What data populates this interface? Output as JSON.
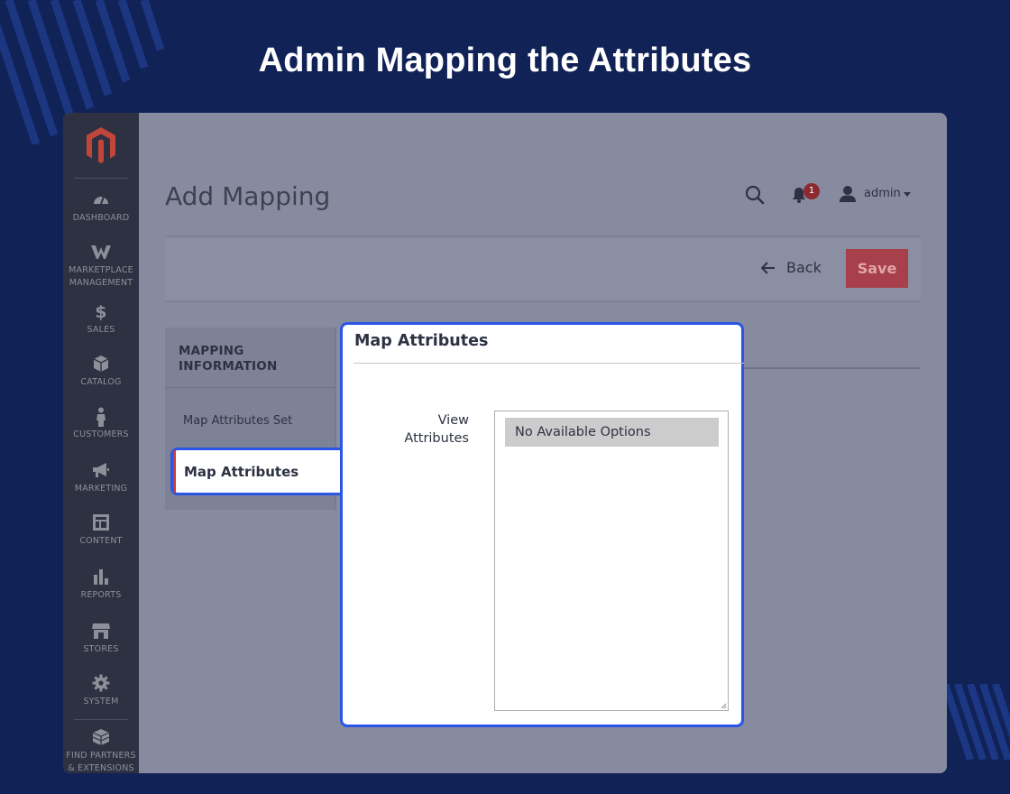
{
  "banner": {
    "title": "Admin Mapping the Attributes"
  },
  "colors": {
    "background": "#112256",
    "accent": "#2a55e6",
    "save": "#a7404a",
    "sidebar": "#2d3142"
  },
  "sidebar": {
    "items": [
      {
        "label": "DASHBOARD",
        "icon": "dashboard-icon"
      },
      {
        "label": "MARKETPLACE MANAGEMENT",
        "icon": "marketplace-icon"
      },
      {
        "label": "SALES",
        "icon": "dollar-icon"
      },
      {
        "label": "CATALOG",
        "icon": "box-icon"
      },
      {
        "label": "CUSTOMERS",
        "icon": "person-icon"
      },
      {
        "label": "MARKETING",
        "icon": "megaphone-icon"
      },
      {
        "label": "CONTENT",
        "icon": "layout-icon"
      },
      {
        "label": "REPORTS",
        "icon": "bar-chart-icon"
      },
      {
        "label": "STORES",
        "icon": "store-icon"
      },
      {
        "label": "SYSTEM",
        "icon": "gear-icon"
      },
      {
        "label": "FIND PARTNERS & EXTENSIONS",
        "icon": "cubes-icon"
      }
    ]
  },
  "header": {
    "page_title": "Add Mapping",
    "notifications_count": "1",
    "user_name": "admin"
  },
  "actions": {
    "back_label": "Back",
    "save_label": "Save"
  },
  "tabs": {
    "section_title": "MAPPING INFORMATION",
    "items": [
      {
        "label": "Map Attributes Set"
      },
      {
        "label": "Map Attributes"
      }
    ]
  },
  "panel": {
    "title": "Map Attributes",
    "field_label": "View Attributes",
    "options": [
      "No Available Options"
    ]
  }
}
